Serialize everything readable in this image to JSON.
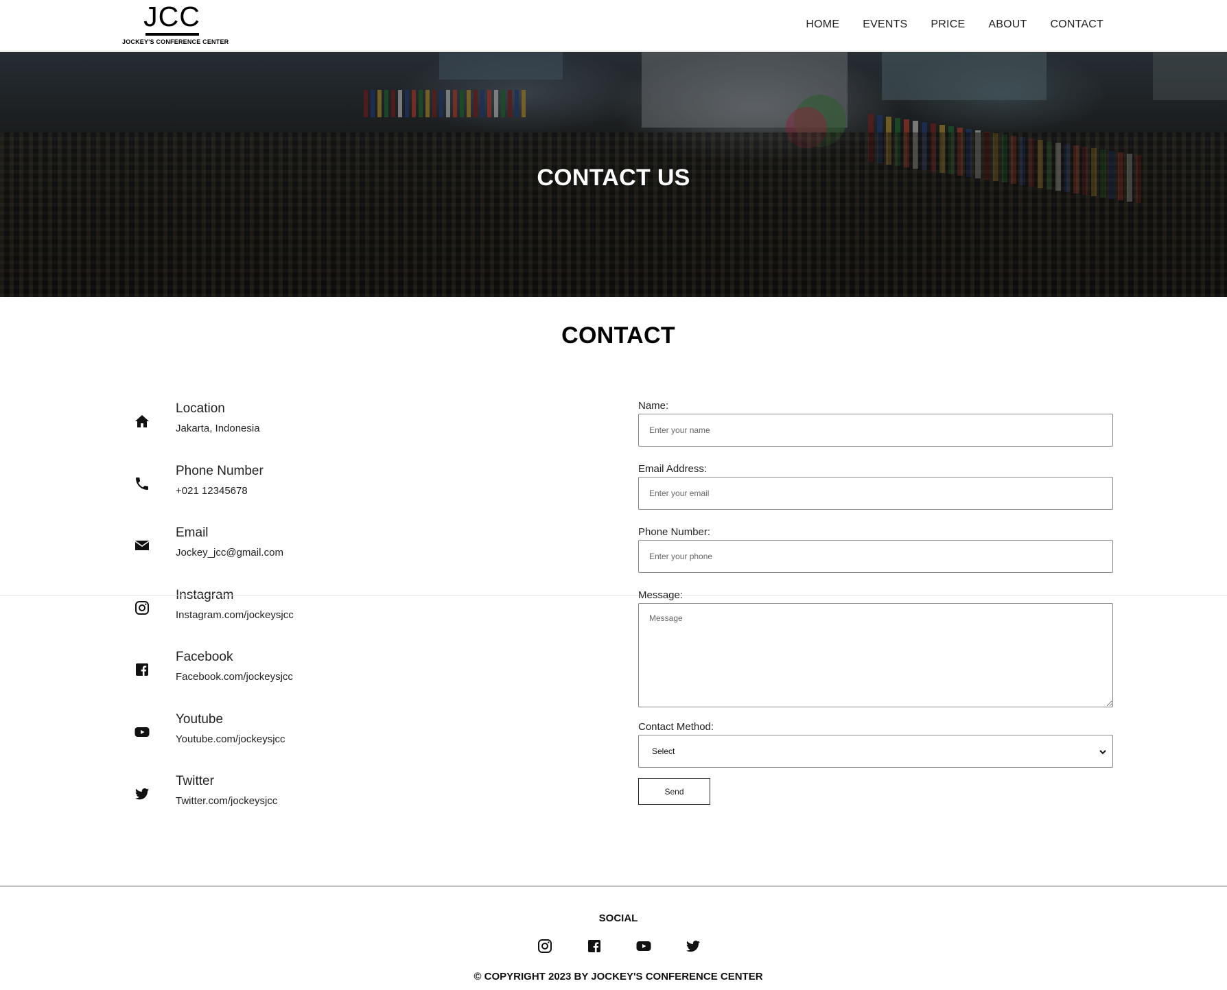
{
  "logo": {
    "mark": "JCC",
    "subtitle": "JOCKEY'S CONFERENCE CENTER"
  },
  "nav": {
    "items": [
      "HOME",
      "EVENTS",
      "PRICE",
      "ABOUT",
      "CONTACT"
    ]
  },
  "hero": {
    "title": "CONTACT US"
  },
  "contact": {
    "section_title": "CONTACT",
    "info": [
      {
        "icon": "home-icon",
        "title": "Location",
        "value": "Jakarta, Indonesia"
      },
      {
        "icon": "phone-icon",
        "title": "Phone Number",
        "value": "+021 12345678"
      },
      {
        "icon": "envelope-icon",
        "title": "Email",
        "value": "Jockey_jcc@gmail.com"
      },
      {
        "icon": "instagram-icon",
        "title": "Instagram",
        "value": "Instagram.com/jockeysjcc"
      },
      {
        "icon": "facebook-icon",
        "title": "Facebook",
        "value": "Facebook.com/jockeysjcc"
      },
      {
        "icon": "youtube-icon",
        "title": "Youtube",
        "value": "Youtube.com/jockeysjcc"
      },
      {
        "icon": "twitter-icon",
        "title": "Twitter",
        "value": "Twitter.com/jockeysjcc"
      }
    ]
  },
  "form": {
    "name_label": "Name:",
    "name_placeholder": "Enter your name",
    "email_label": "Email Address:",
    "email_placeholder": "Enter your email",
    "phone_label": "Phone Number:",
    "phone_placeholder": "Enter your phone",
    "message_label": "Message:",
    "message_placeholder": "Message",
    "method_label": "Contact Method:",
    "method_selected": "Select",
    "send_label": "Send"
  },
  "footer": {
    "social_title": "SOCIAL",
    "icons": [
      "instagram-icon",
      "facebook-icon",
      "youtube-icon",
      "twitter-icon"
    ],
    "copyright": "© COPYRIGHT 2023 BY JOCKEY'S CONFERENCE CENTER"
  }
}
